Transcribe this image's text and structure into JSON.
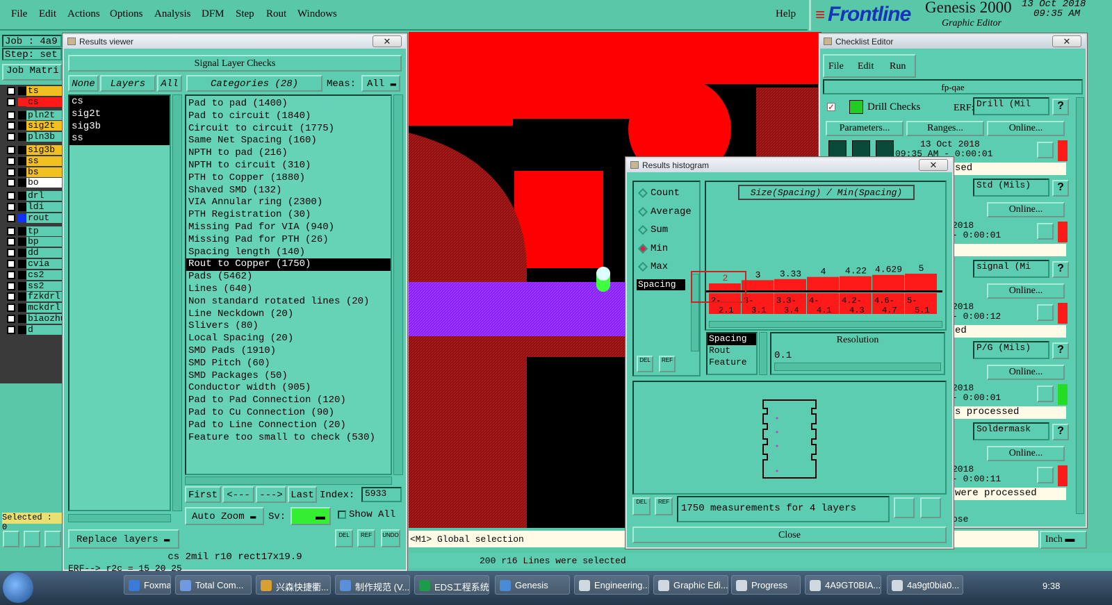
{
  "menu": [
    "File",
    "Edit",
    "Actions",
    "Options",
    "Analysis",
    "DFM",
    "Step",
    "Rout",
    "Windows"
  ],
  "help": "Help",
  "brand": {
    "logo": "Frontline",
    "product": "Genesis 2000",
    "subtitle": "Graphic Editor",
    "date": "13 Oct 2018",
    "time": "09:35 AM"
  },
  "left_panel": {
    "job": "Job : 4a9",
    "step": "Step: set",
    "matrix": "Job Matri",
    "selected": "Selected : 0",
    "layers": [
      {
        "name": "ts",
        "color": "#f0c020"
      },
      {
        "name": "cs",
        "color": "#ff1a1a"
      },
      {
        "name": "pln2t",
        "color": "#5ccdb0"
      },
      {
        "name": "sig2t",
        "color": "#f0c020"
      },
      {
        "name": "pln3b",
        "color": "#5ccdb0"
      },
      {
        "name": "sig3b",
        "color": "#f0c020"
      },
      {
        "name": "ss",
        "color": "#f0c020"
      },
      {
        "name": "bs",
        "color": "#f0c020"
      },
      {
        "name": "bo",
        "color": "#ffffff"
      },
      {
        "name": "drl",
        "color": "#5ccdb0"
      },
      {
        "name": "ldi",
        "color": "#5ccdb0"
      },
      {
        "name": "rout",
        "color": "#5ccdb0"
      },
      {
        "name": "tp",
        "color": "#5ccdb0"
      },
      {
        "name": "bp",
        "color": "#5ccdb0"
      },
      {
        "name": "dd",
        "color": "#5ccdb0"
      },
      {
        "name": "cvia",
        "color": "#5ccdb0"
      },
      {
        "name": "cs2",
        "color": "#5ccdb0"
      },
      {
        "name": "ss2",
        "color": "#5ccdb0"
      },
      {
        "name": "fzkdrl",
        "color": "#5ccdb0"
      },
      {
        "name": "mckdrl",
        "color": "#5ccdb0"
      },
      {
        "name": "biaozhu",
        "color": "#5ccdb0"
      },
      {
        "name": "d",
        "color": "#5ccdb0"
      }
    ]
  },
  "results_viewer": {
    "title": "Results viewer",
    "header": "Signal Layer Checks",
    "none": "None",
    "layers_btn": "Layers",
    "all": "All",
    "categories_btn": "Categories (28)",
    "meas_label": "Meas:",
    "meas_value": "All",
    "layers": [
      "cs",
      "sig2t",
      "sig3b",
      "ss"
    ],
    "categories": [
      "Pad to pad (1400)",
      "Pad to circuit (1840)",
      "Circuit to circuit (1775)",
      "Same Net Spacing (160)",
      "NPTH to pad (216)",
      "NPTH to circuit (310)",
      "PTH to Copper (1880)",
      "Shaved SMD (132)",
      "VIA Annular ring (2300)",
      "PTH Registration (30)",
      "Missing Pad for VIA (940)",
      "Missing Pad for PTH (26)",
      "Spacing length (140)",
      "Rout to Copper (1750)",
      "Pads (5462)",
      "Lines (640)",
      "Non standard rotated lines (20)",
      "Line Neckdown (20)",
      "Slivers (80)",
      "Local Spacing (20)",
      "SMD Pads (1910)",
      "SMD Pitch (60)",
      "SMD Packages (50)",
      "Conductor width (905)",
      "Pad to Pad Connection (120)",
      "Pad to Cu Connection (90)",
      "Pad to Line Connection (20)",
      "Feature too small to check (530)"
    ],
    "selected_index": 13,
    "first": "First",
    "prev": "<---",
    "next": "--->",
    "last": "Last",
    "index_label": "Index:",
    "index_value": "5933",
    "auto_zoom": "Auto Zoom",
    "sv": "Sv:",
    "show_all": "Show All",
    "replace_layers": "Replace layers",
    "del": "DEL",
    "ref": "REF",
    "undo": "UNDO"
  },
  "status": {
    "cs_line": "cs 2mil  r10  rect17x19.9",
    "erf": "ERF--> r2c = 15 20 25",
    "global_sel": "<M1> Global selection",
    "lines_sel": "200 r16 Lines were selected"
  },
  "histogram": {
    "title": "Results histogram",
    "chart_title": "Size(Spacing) / Min(Spacing)",
    "options": [
      "Count",
      "Average",
      "Sum",
      "Min",
      "Max"
    ],
    "selected_option": "Min",
    "field": "Spacing",
    "list": [
      "Spacing",
      "Rout",
      "Feature"
    ],
    "resolution_label": "Resolution",
    "resolution": "0.1",
    "summary": "1750 measurements for 4 layers",
    "close": "Close"
  },
  "chart_data": {
    "type": "bar",
    "title": "Size(Spacing) / Min(Spacing)",
    "categories": [
      "2-2.1",
      "3-3.1",
      "3.3-3.4",
      "4-4.1",
      "4.2-4.3",
      "4.6-4.7",
      "5-5.1"
    ],
    "labels": [
      "2",
      "3",
      "3.33",
      "4",
      "4.22",
      "4.629",
      "5"
    ],
    "values": [
      2,
      3,
      3.33,
      4,
      4.22,
      4.629,
      5
    ]
  },
  "checklist": {
    "title": "Checklist Editor",
    "menu": [
      "File",
      "Edit",
      "Run"
    ],
    "name": "fp-qae",
    "checks": [
      {
        "name": "Drill Checks",
        "erf": "Drill (Mil",
        "date": "13 Oct 2018",
        "time": "09:35 AM - 0:00:01",
        "status": "sed",
        "status_color": "#ff1a1a"
      },
      {
        "erf": "Std (Mils)",
        "date": "2018",
        "time": "- 0:00:01",
        "status": "",
        "status_color": "#ff1a1a"
      },
      {
        "erf": "signal (Mi",
        "date": "2018",
        "time": "- 0:00:12",
        "status": "ed",
        "status_color": "#ff1a1a"
      },
      {
        "erf": "P/G (Mils)",
        "date": "2018",
        "time": "- 0:00:01",
        "status": "s processed",
        "status_color": "#22dd22"
      },
      {
        "erf": "Soldermask",
        "date": "2018",
        "time": "- 0:00:11",
        "status": "were processed",
        "status_color": "#ff1a1a"
      }
    ],
    "erf_label": "ERF:",
    "params": "Parameters...",
    "ranges": "Ranges...",
    "online": "Online...",
    "footer": "ose"
  },
  "units": "Inch",
  "taskbar": {
    "items": [
      "Foxmail",
      "Total Com...",
      "兴森快捷衢...",
      "制作规范 (V...",
      "EDS工程系统",
      "Genesis",
      "Engineering...",
      "Graphic Edi...",
      "Progress",
      "4A9GT0BIA...",
      "4a9gt0bia0..."
    ],
    "clock": "9:38"
  }
}
